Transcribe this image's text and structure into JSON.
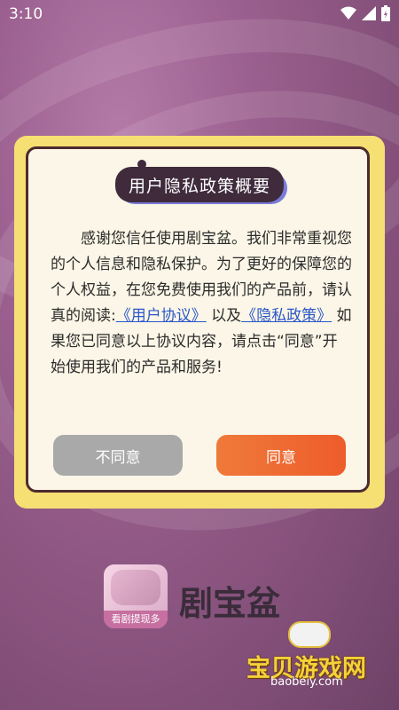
{
  "status_bar": {
    "time": "3:10",
    "icons": [
      "wifi-icon",
      "signal-icon",
      "battery-charging-icon"
    ]
  },
  "dialog": {
    "title": "用户隐私政策概要",
    "body": {
      "intro": "感谢您信任使用剧宝盆。我们非常重视您的个人信息和隐私保护。为了更好的保障您的个人权益，在您免费使用我们的产品前，请认真的阅读:",
      "user_agreement_link": "《用户协议》",
      "connector": "以及",
      "privacy_policy_link": "《隐私政策》",
      "outro": "如果您已同意以上协议内容，请点击“同意”开始使用我们的产品和服务!"
    },
    "buttons": {
      "decline": "不同意",
      "agree": "同意"
    }
  },
  "app": {
    "name": "剧宝盆",
    "logo_caption": "看剧提现多"
  },
  "watermark": {
    "main": "宝贝游戏网",
    "sub": "baobeiy.com"
  },
  "colors": {
    "dialog_border_yellow": "#f6df73",
    "agree_button": "#ee5c2b",
    "decline_button": "#a9a9a9",
    "link": "#2b57c9"
  }
}
